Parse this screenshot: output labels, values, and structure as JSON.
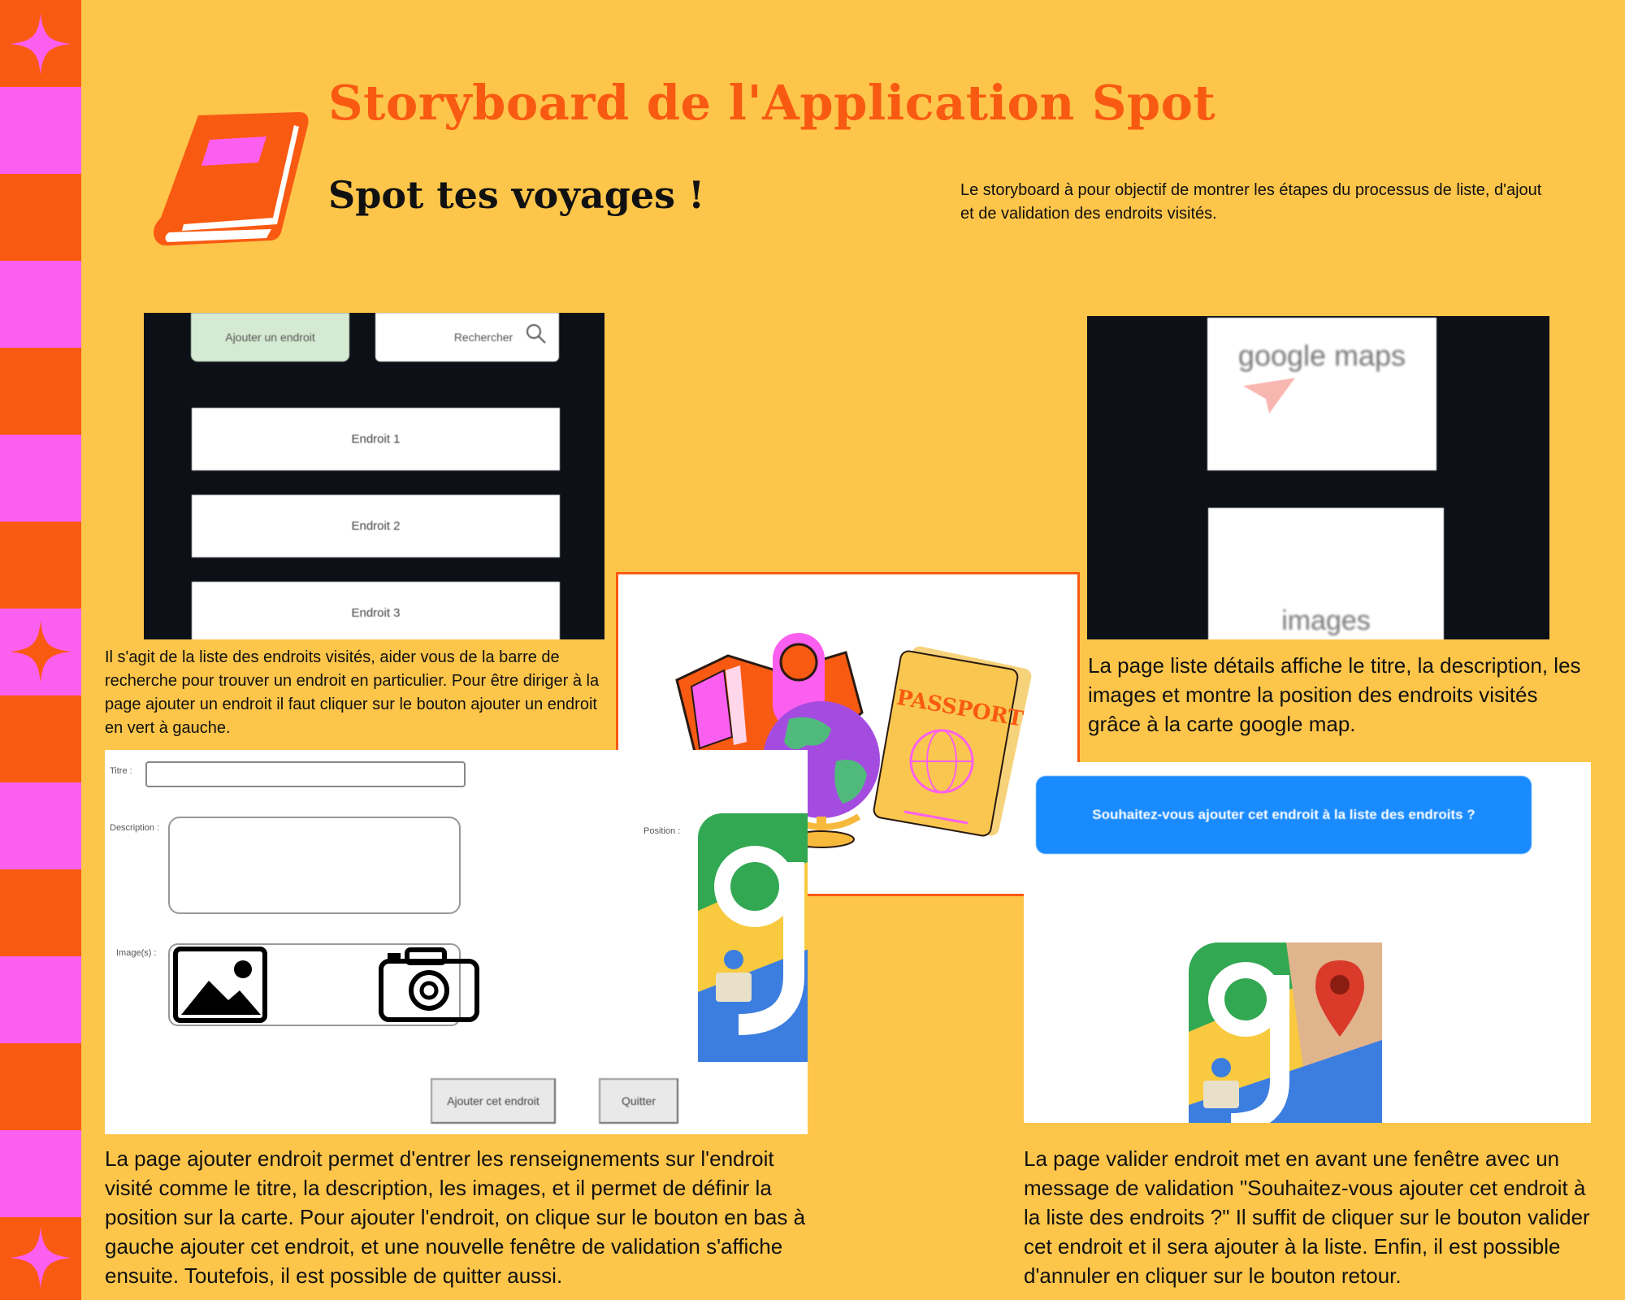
{
  "header": {
    "title": "Storyboard de l'Application Spot",
    "subtitle": "Spot tes voyages !",
    "intro": "Le storyboard à pour objectif de montrer les étapes du processus de liste, d'ajout et de validation des endroits visités."
  },
  "icons": [
    "book-icon",
    "sparkle-icon",
    "search-icon",
    "image-icon",
    "camera-icon",
    "google-maps-icon",
    "globe-icon",
    "passport-icon",
    "map-icon"
  ],
  "colors": {
    "background": "#fdc54a",
    "accent": "#f95a12",
    "pink": "#fb5ff0"
  },
  "list_screen": {
    "add_button": "Ajouter un endroit",
    "search_label": "Rechercher",
    "items": [
      "Endroit 1",
      "Endroit 2",
      "Endroit 3"
    ],
    "caption": "Il s'agit de la liste des endroits visités, aider vous de la barre de recherche pour trouver un endroit en particulier. Pour être diriger à la page ajouter un endroit il faut cliquer sur le bouton ajouter un endroit en vert à gauche."
  },
  "details_screen": {
    "map_label": "google maps",
    "images_label": "images",
    "caption": "La page liste détails affiche le titre, la description, les images et montre la position des endroits visités grâce à la carte google map."
  },
  "illustration": {
    "passport_text": "PASSPORT"
  },
  "add_screen": {
    "title_label": "Titre :",
    "description_label": "Description :",
    "images_label": "Image(s) :",
    "position_label": "Position :",
    "add_button": "Ajouter cet endroit",
    "quit_button": "Quitter",
    "caption": "La page ajouter endroit permet d'entrer les renseignements sur l'endroit visité comme le titre, la description, les images, et il permet de définir la position sur la carte. Pour ajouter l'endroit, on clique sur le bouton en bas à gauche ajouter cet endroit, et une nouvelle fenêtre de validation s'affiche ensuite. Toutefois, il est possible de quitter aussi."
  },
  "validate_screen": {
    "message": "Souhaitez-vous ajouter cet endroit à la liste des endroits ?",
    "caption": "La page valider endroit met en avant une fenêtre avec un message de validation \"Souhaitez-vous ajouter cet endroit à la liste des endroits ?\" Il suffit de cliquer sur le bouton valider cet endroit et il sera ajouter à la liste. Enfin, il est possible d'annuler en cliquer sur le bouton retour."
  }
}
